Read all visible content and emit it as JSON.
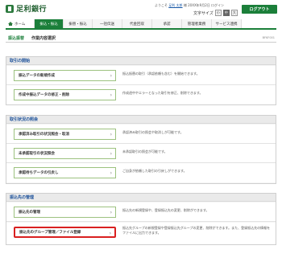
{
  "header": {
    "bank_name": "足利銀行",
    "user_line_prefix": "ようこそ",
    "user_name": "足利 太郎",
    "user_line_suffix": "様 20XX年9月2日 ログイン",
    "font_size_label": "文字サイズ",
    "font_sizes": [
      "小",
      "中",
      "大"
    ],
    "logout_label": "ログアウト"
  },
  "nav": {
    "items": [
      "ホーム",
      "振込・振込",
      "振替・振込",
      "一括伝送",
      "代金回収",
      "承認",
      "管理者業務",
      "サービス連携"
    ]
  },
  "page": {
    "title_main": "振込振替",
    "title_sub": "作業内容選択",
    "screen_id": "BFKF001"
  },
  "sections": [
    {
      "heading": "取引の開始",
      "rows": [
        {
          "button": "振込データの新規作成",
          "description": "振込振替の取引（承認依頼も含む）を開始できます。"
        },
        {
          "button": "作成中振込データの修正・削除",
          "description": "作成途中やエラーとなった取引を修正、削除できます。"
        }
      ]
    },
    {
      "heading": "取引状況の照会",
      "rows": [
        {
          "button": "承認済み取引の状況照会・取消",
          "description": "承認済み取引の照会や取消しが可能です。"
        },
        {
          "button": "未承認取引の状況照会",
          "description": "未承認取引の照会が可能です。"
        },
        {
          "button": "承認待ちデータの引戻し",
          "description": "ご自身が依頼した取引の引戻しができます。"
        }
      ]
    },
    {
      "heading": "振込先の管理",
      "rows": [
        {
          "button": "振込先の管理",
          "description": "振込先の新規登録や、登録振込先の変更、削除ができます。"
        },
        {
          "button": "振込先のグループ管理／ファイル登録",
          "description": "振込先グループの新規登録や登録振込先グループの変更、削除ができます。また、登録振込先の情報をファイルに出力できます。"
        }
      ]
    }
  ]
}
